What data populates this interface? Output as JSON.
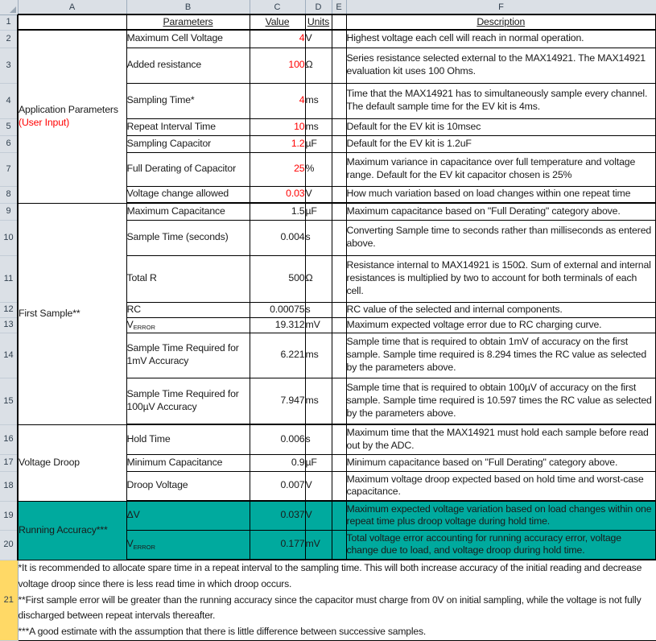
{
  "columns": [
    "A",
    "B",
    "C",
    "D",
    "E",
    "F"
  ],
  "row_numbers": [
    "1",
    "2",
    "3",
    "4",
    "5",
    "6",
    "7",
    "8",
    "9",
    "10",
    "11",
    "12",
    "13",
    "14",
    "15",
    "16",
    "17",
    "18",
    "19",
    "20",
    "21"
  ],
  "headers": {
    "a": "",
    "parameters": "Parameters",
    "value": "Value",
    "units": "Units",
    "e": "",
    "description": "Description"
  },
  "sections": {
    "application_parameters": {
      "title_line1": "Application Parameters",
      "title_line2": "(User Input)"
    },
    "first_sample": {
      "title": "First Sample**"
    },
    "voltage_droop": {
      "title": "Voltage Droop"
    },
    "running_accuracy": {
      "title": "Running Accuracy***"
    }
  },
  "rows": {
    "r2": {
      "parameter": "Maximum Cell Voltage",
      "value": "4",
      "units": "V",
      "description": "Highest voltage each cell will reach in normal operation."
    },
    "r3": {
      "parameter": "Added resistance",
      "value": "100",
      "units": "Ω",
      "description": "Series resistance selected external to the MAX14921. The MAX14921 evaluation kit uses 100 Ohms."
    },
    "r4": {
      "parameter": "Sampling Time*",
      "value": "4",
      "units": "ms",
      "description": "Time that the MAX14921 has to simultaneously sample every channel. The default sample time for the EV kit is 4ms."
    },
    "r5": {
      "parameter": "Repeat Interval Time",
      "value": "10",
      "units": "ms",
      "description": "Default for the EV kit is 10msec"
    },
    "r6": {
      "parameter": "Sampling Capacitor",
      "value": "1.2",
      "units": "µF",
      "description": "Default for the EV kit is 1.2uF"
    },
    "r7": {
      "parameter": "Full Derating of Capacitor",
      "value": "25",
      "units": "%",
      "description": "Maximum variance in capacitance over full temperature and voltage range. Default for the EV kit capacitor chosen is 25%"
    },
    "r8": {
      "parameter": "Voltage change allowed",
      "value": "0.03",
      "units": "V",
      "description": "How much variation based on load changes within one repeat time"
    },
    "r9": {
      "parameter": "Maximum Capacitance",
      "value": "1.5",
      "units": "µF",
      "description": "Maximum capacitance based on \"Full Derating\" category above."
    },
    "r10": {
      "parameter": "Sample Time (seconds)",
      "value": "0.004",
      "units": "s",
      "description": "Converting Sample time to seconds rather than milliseconds as entered above."
    },
    "r11": {
      "parameter": "Total R",
      "value": "500",
      "units": "Ω",
      "description": "Resistance internal to MAX14921 is 150Ω. Sum of external and internal resistances is multiplied by two to account for both terminals of each cell."
    },
    "r12": {
      "parameter": "RC",
      "value": "0.00075",
      "units": "s",
      "description": "RC value of the selected and internal components."
    },
    "r13": {
      "parameter_prefix": "V",
      "parameter_sub": "ERROR",
      "value": "19.312",
      "units": "mV",
      "description": "Maximum expected voltage error due to RC charging curve."
    },
    "r14": {
      "parameter": "Sample Time Required for 1mV Accuracy",
      "value": "6.221",
      "units": "ms",
      "description": "Sample time that is required to obtain 1mV of accuracy on the first sample. Sample time required is 8.294 times the RC value as selected by the parameters above."
    },
    "r15": {
      "parameter": "Sample Time Required for 100µV Accuracy",
      "value": "7.947",
      "units": "ms",
      "description": "Sample time that is required to obtain 100µV of accuracy on the first sample. Sample time required is 10.597 times the RC value as selected by the parameters above."
    },
    "r16": {
      "parameter": "Hold Time",
      "value": "0.006",
      "units": "s",
      "description": "Maximum time that the MAX14921 must hold each sample before read out by the ADC."
    },
    "r17": {
      "parameter": "Minimum Capacitance",
      "value": "0.9",
      "units": "µF",
      "description": "Minimum capacitance based on \"Full Derating\" category above."
    },
    "r18": {
      "parameter": "Droop Voltage",
      "value": "0.007",
      "units": "V",
      "description": "Maximum voltage droop expected based on hold time and worst-case capacitance."
    },
    "r19": {
      "parameter": "ΔV",
      "value": "0.037",
      "units": "V",
      "description": "Maximum expected voltage variation based on load changes within one repeat time plus droop voltage during hold time."
    },
    "r20": {
      "parameter_prefix": "V",
      "parameter_sub": "ERROR",
      "value": "0.177",
      "units": "mV",
      "description": "Total voltage error accounting for running accuracy error, voltage change due to load, and voltage droop during hold time."
    }
  },
  "footnotes": {
    "one": "*It is recommended to allocate spare time in a repeat interval to the sampling time. This will both increase accuracy of the initial reading and decrease voltage droop since there is less read time in which droop occurs.",
    "two": "**First sample error will be greater than the running accuracy since the capacitor must charge from 0V on initial sampling, while the voltage is not fully discharged between repeat intervals thereafter.",
    "three": "***A good estimate with the assumption that there is little difference between successive samples."
  },
  "colors": {
    "accent_teal": "#00AA9E",
    "input_red": "#FF0000",
    "footnote_highlight": "#FFD966",
    "header_gray": "#DBE0E6"
  }
}
